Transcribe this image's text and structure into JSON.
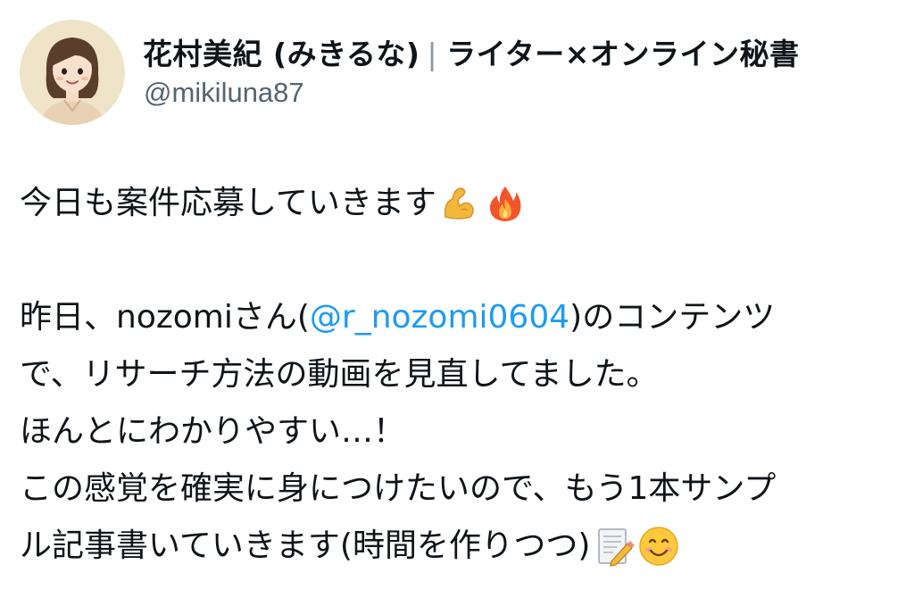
{
  "profile": {
    "display_name": "花村美紀 (みきるな)",
    "separator": "|",
    "display_name_suffix": "ライター×オンライン秘書",
    "handle": "@mikiluna87"
  },
  "tweet": {
    "line1": "今日も案件応募していきます",
    "line3_prefix": "昨日、nozomiさん(",
    "mention": "@r_nozomi0604",
    "line3_suffix": ")のコンテンツ",
    "line4": "で、リサーチ方法の動画を見直してました。",
    "line5": "ほんとにわかりやすい…！",
    "line6": "この感覚を確実に身につけたいので、もう1本サンプ",
    "line7": "ル記事書いていきます(時間を作りつつ)"
  },
  "emojis": [
    "flexed-biceps-icon",
    "fire-icon",
    "memo-icon",
    "smiling-face-icon"
  ],
  "colors": {
    "mention": "#1d9bf0",
    "handle": "#536471",
    "text": "#0f1419"
  }
}
